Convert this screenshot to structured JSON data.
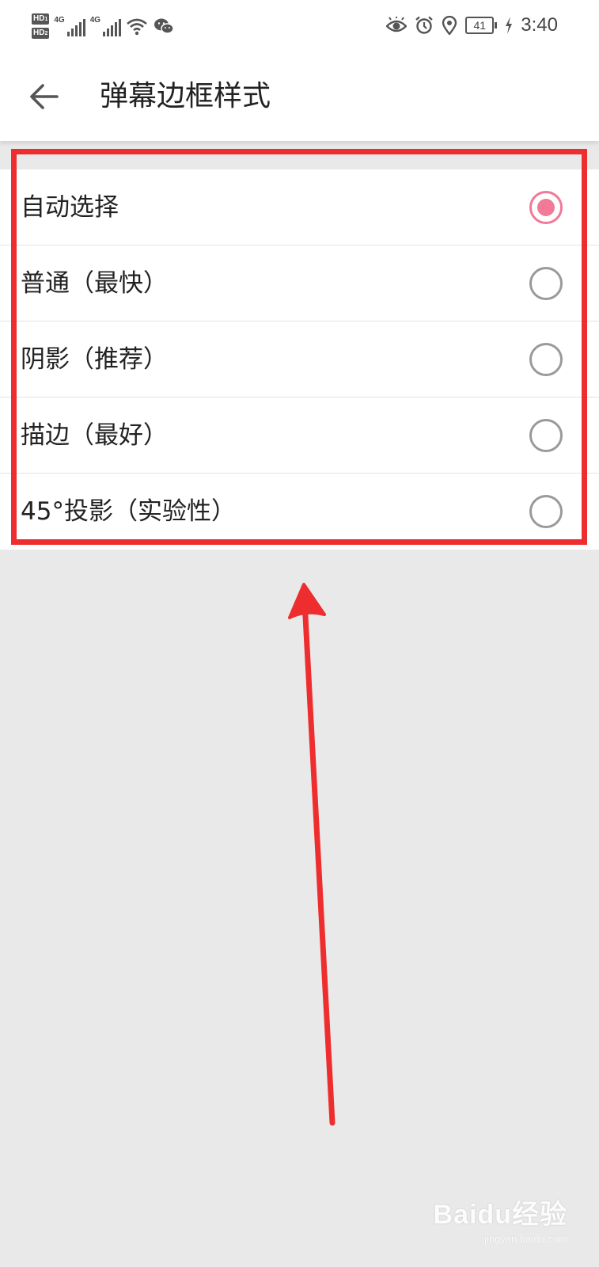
{
  "status_bar": {
    "sim1": "HD",
    "sim2": "HD",
    "net1": "4G",
    "net2": "4G",
    "icons": [
      "eye-icon",
      "alarm-icon",
      "location-icon"
    ],
    "battery": "41",
    "time": "3:40"
  },
  "app_bar": {
    "back_icon": "back-arrow-icon",
    "title": "弹幕边框样式"
  },
  "options": [
    {
      "label": "自动选择",
      "selected": true
    },
    {
      "label": "普通（最快）",
      "selected": false
    },
    {
      "label": "阴影（推荐）",
      "selected": false
    },
    {
      "label": "描边（最好）",
      "selected": false
    },
    {
      "label": "45°投影（实验性）",
      "selected": false
    }
  ],
  "annotation": {
    "color": "#ee2e2e"
  },
  "colors": {
    "accent": "#f07a98",
    "background": "#e9e9e9"
  },
  "watermark": {
    "main": "Baidu经验",
    "sub": "jingyan.baidu.com"
  }
}
